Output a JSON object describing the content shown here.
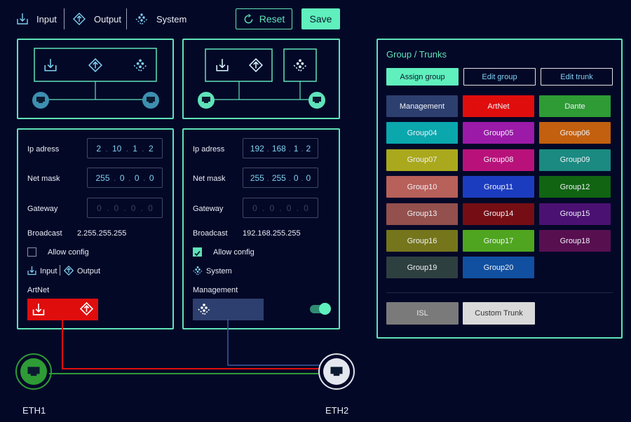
{
  "nav": {
    "input_label": "Input",
    "output_label": "Output",
    "system_label": "System"
  },
  "toolbar": {
    "reset_label": "Reset",
    "save_label": "Save"
  },
  "eth1_panel": {
    "ip_label": "Ip adress",
    "ip": [
      "2",
      "10",
      "1",
      "2"
    ],
    "mask_label": "Net mask",
    "mask": [
      "255",
      "0",
      "0",
      "0"
    ],
    "gateway_label": "Gateway",
    "gateway": [
      "0",
      "0",
      "0",
      "0"
    ],
    "broadcast_label": "Broadcast",
    "broadcast": "2.255.255.255",
    "allow_config_label": "Allow config",
    "allow_config": false,
    "input_label": "Input",
    "output_label": "Output",
    "group_label": "ArtNet"
  },
  "eth2_panel": {
    "ip_label": "Ip adress",
    "ip": [
      "192",
      "168",
      "1",
      "2"
    ],
    "mask_label": "Net mask",
    "mask": [
      "255",
      "255",
      "0",
      "0"
    ],
    "gateway_label": "Gateway",
    "gateway": [
      "0",
      "0",
      "0",
      "0"
    ],
    "broadcast_label": "Broadcast",
    "broadcast": "192.168.255.255",
    "allow_config_label": "Allow config",
    "allow_config": true,
    "system_label": "System",
    "group_label": "Management",
    "toggle_on": true
  },
  "ports": {
    "eth1_label": "ETH1",
    "eth2_label": "ETH2"
  },
  "groups_panel": {
    "title": "Group / Trunks",
    "assign_label": "Assign group",
    "edit_group_label": "Edit group",
    "edit_trunk_label": "Edit trunk",
    "groups": [
      {
        "label": "Management",
        "color": "#2d3f6e"
      },
      {
        "label": "ArtNet",
        "color": "#e00d0d"
      },
      {
        "label": "Dante",
        "color": "#2e9b35"
      },
      {
        "label": "Group04",
        "color": "#0aa7ad"
      },
      {
        "label": "Group05",
        "color": "#9b1aa8"
      },
      {
        "label": "Group06",
        "color": "#c2600f"
      },
      {
        "label": "Group07",
        "color": "#aaa81c"
      },
      {
        "label": "Group08",
        "color": "#b8127a"
      },
      {
        "label": "Group09",
        "color": "#1b8a80"
      },
      {
        "label": "Group10",
        "color": "#b8605a"
      },
      {
        "label": "Group11",
        "color": "#1c3cc0"
      },
      {
        "label": "Group12",
        "color": "#106412"
      },
      {
        "label": "Group13",
        "color": "#93504c"
      },
      {
        "label": "Group14",
        "color": "#750e14"
      },
      {
        "label": "Group15",
        "color": "#4b1172"
      },
      {
        "label": "Group16",
        "color": "#75751c"
      },
      {
        "label": "Group17",
        "color": "#4fa51f"
      },
      {
        "label": "Group18",
        "color": "#570f50"
      },
      {
        "label": "Group19",
        "color": "#2e3f40"
      },
      {
        "label": "Group20",
        "color": "#1150a0"
      }
    ],
    "isl_label": "ISL",
    "custom_trunk_label": "Custom Trunk"
  },
  "colors": {
    "accent": "#5fe3b9",
    "background": "#040827",
    "artnet": "#e00d0d",
    "management": "#2d3f6e"
  }
}
